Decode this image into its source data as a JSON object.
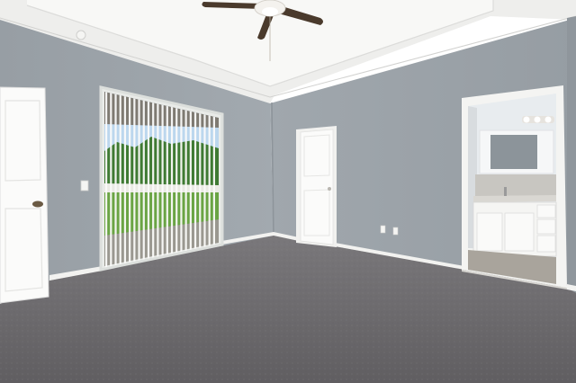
{
  "scene": {
    "subject": "empty-bedroom-interior",
    "elements": [
      "tray-ceiling",
      "ceiling-fan",
      "sliding-glass-door-with-vertical-blinds",
      "white-interior-door-left",
      "closet-door",
      "ensuite-bathroom-vanity",
      "vanity-mirror",
      "vanity-light",
      "carpet-floor",
      "baseboards",
      "light-switch",
      "wall-outlets"
    ],
    "colors": {
      "wall": "#9ea5ab",
      "wall_shadow": "#8e959b",
      "ceiling": "#f3f3f1",
      "ceiling_tray": "#fafaf8",
      "carpet": "#6d6b6e",
      "carpet_light": "#7b797c",
      "trim": "#f7f7f5",
      "door": "#fbfbfa",
      "fan_blade": "#4a3a2c",
      "grass": "#6aa444",
      "sky": "#bcd7ee",
      "trees": "#3f7a33",
      "vanity": "#f5f5f3",
      "counter": "#d9d7d2",
      "mirror_glass": "#8c949a",
      "bath_floor": "#a9a49c"
    }
  }
}
